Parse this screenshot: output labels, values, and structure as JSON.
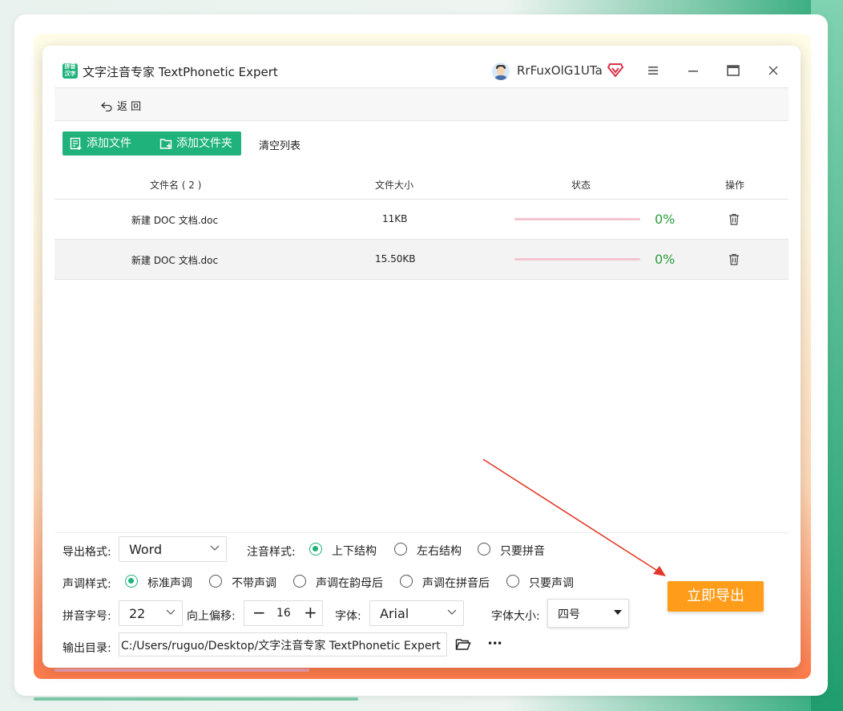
{
  "app": {
    "logo_text": "拼音汉字",
    "title": "文字注音专家 TextPhonetic Expert",
    "username": "RrFuxOlG1UTa"
  },
  "nav": {
    "back_label": "返 回"
  },
  "toolbar": {
    "add_file_label": "添加文件",
    "add_folder_label": "添加文件夹",
    "clear_label": "清空列表"
  },
  "table": {
    "headers": {
      "name": "文件名 ( 2 )",
      "size": "文件大小",
      "status": "状态",
      "action": "操作"
    },
    "rows": [
      {
        "name": "新建 DOC 文档.doc",
        "size": "11KB",
        "progress": "0%"
      },
      {
        "name": "新建 DOC 文档.doc",
        "size": "15.50KB",
        "progress": "0%"
      }
    ]
  },
  "options": {
    "export_format_label": "导出格式:",
    "export_format_value": "Word",
    "annotation_style_label": "注音样式:",
    "annotation_styles": [
      {
        "label": "上下结构",
        "selected": true
      },
      {
        "label": "左右结构",
        "selected": false
      },
      {
        "label": "只要拼音",
        "selected": false
      }
    ],
    "tone_style_label": "声调样式:",
    "tone_styles": [
      {
        "label": "标准声调",
        "selected": true
      },
      {
        "label": "不带声调",
        "selected": false
      },
      {
        "label": "声调在韵母后",
        "selected": false
      },
      {
        "label": "声调在拼音后",
        "selected": false
      },
      {
        "label": "只要声调",
        "selected": false
      }
    ],
    "pinyin_size_label": "拼音字号:",
    "pinyin_size_value": "22",
    "offset_label": "向上偏移:",
    "offset_value": "16",
    "font_label": "字体:",
    "font_value": "Arial",
    "font_size_label": "字体大小:",
    "font_size_value": "四号",
    "output_dir_label": "输出目录:",
    "output_dir_value": "C:/Users/ruguo/Desktop/文字注音专家 TextPhonetic Expert",
    "more_label": "•••"
  },
  "export_button_label": "立即导出",
  "colors": {
    "accent_green": "#1fb27a",
    "export_orange": "#ff9c1a",
    "progress_green": "#2b9d3a",
    "annotation_arrow": "#e23a2a"
  }
}
